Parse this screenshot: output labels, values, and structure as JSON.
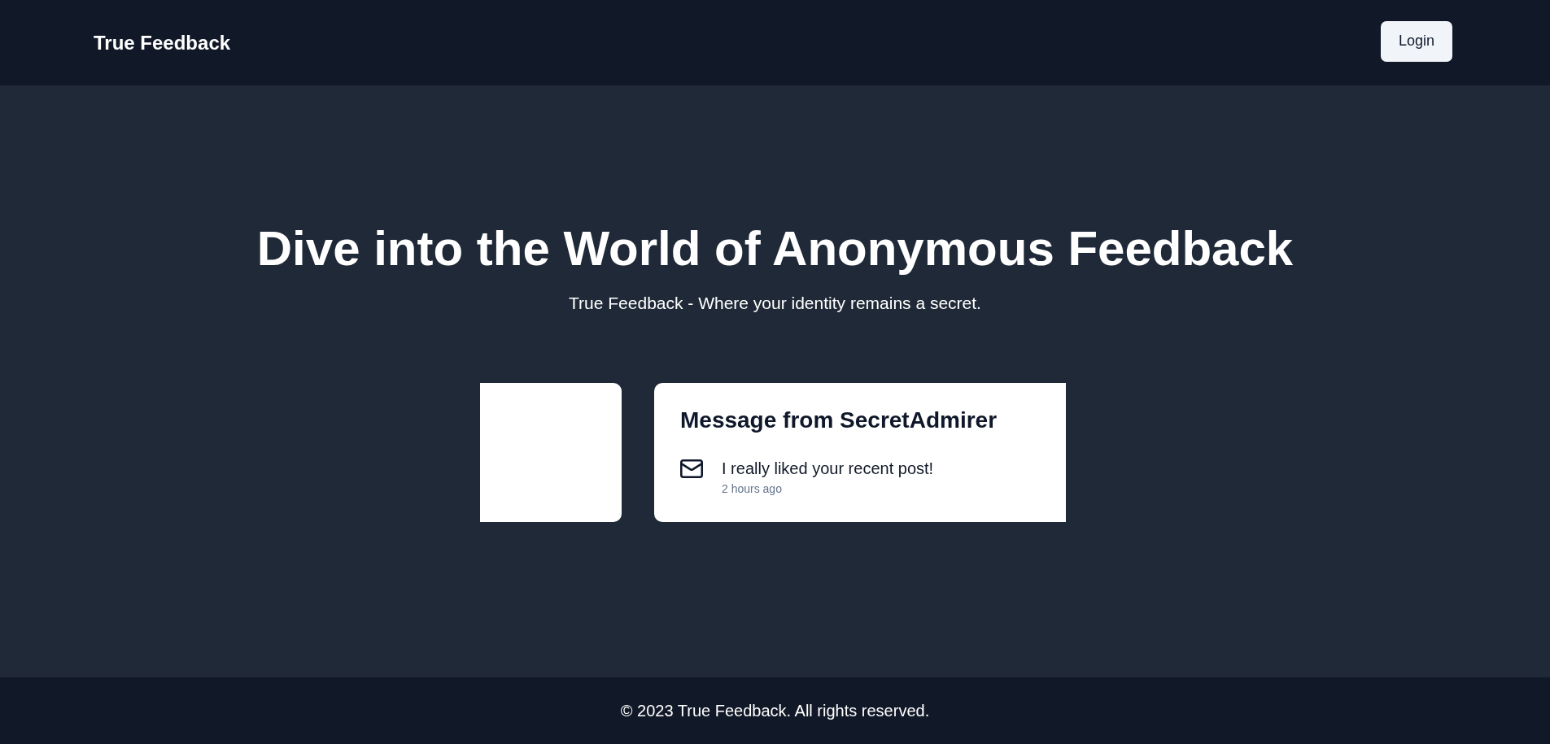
{
  "header": {
    "logo": "True Feedback",
    "login_button": "Login"
  },
  "hero": {
    "title": "Dive into the World of Anonymous Feedback",
    "subtitle": "True Feedback - Where your identity remains a secret."
  },
  "carousel": {
    "messages": [
      {
        "title": "Message from SecretAdmirer",
        "content": "I really liked your recent post!",
        "received": "2 hours ago"
      }
    ]
  },
  "footer": {
    "text": "© 2023 True Feedback. All rights reserved."
  }
}
